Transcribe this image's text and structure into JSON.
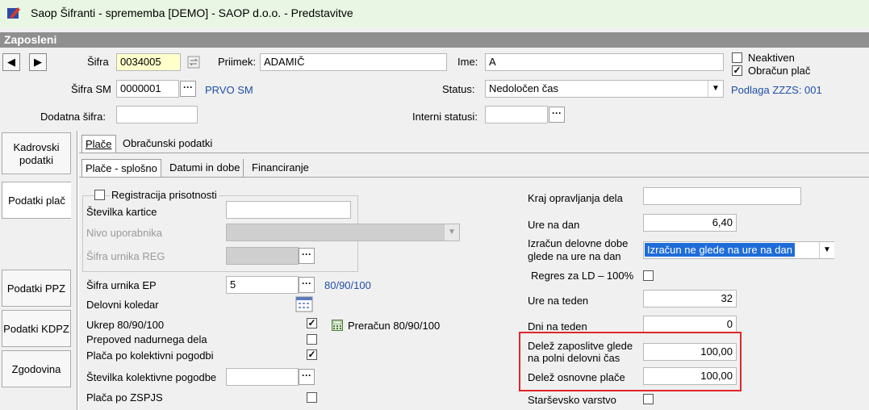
{
  "window": {
    "title": "Saop Šifranti - sprememba [DEMO] - SAOP d.o.o. - Predstavitve"
  },
  "section_title": "Zaposleni",
  "nav": {
    "prev": "◀",
    "next": "▶"
  },
  "top": {
    "sifra_label": "Šifra",
    "sifra_value": "0034005",
    "priimek_label": "Priimek:",
    "priimek_value": "ADAMIČ",
    "ime_label": "Ime:",
    "ime_value": "A",
    "neaktiven_label": "Neaktiven",
    "obracun_label": "Obračun plač",
    "sifra_sm_label": "Šifra SM",
    "sifra_sm_value": "0000001",
    "sm_name": "PRVO SM",
    "status_label": "Status:",
    "status_value": "Nedoločen čas",
    "podlaga": "Podlaga ZZZS: 001",
    "dodatna_label": "Dodatna šifra:",
    "interni_label": "Interni statusi:"
  },
  "sidebar": {
    "kadrovski": "Kadrovski podatki",
    "podatki_plac": "Podatki plač",
    "podatki_ppz": "Podatki PPZ",
    "podatki_kdpz": "Podatki KDPZ",
    "zgodovina": "Zgodovina"
  },
  "tabs": {
    "place": "Plače",
    "obracunski": "Obračunski podatki"
  },
  "subtabs": {
    "splosno": "Plače - splošno",
    "datumi": "Datumi in dobe",
    "financiranje": "Financiranje"
  },
  "left": {
    "registracija": "Registracija prisotnosti",
    "stevilka_kartice": "Številka kartice",
    "nivo": "Nivo uporabnika",
    "sifra_urnika_reg": "Šifra urnika REG",
    "sifra_urnika_ep": "Šifra urnika EP",
    "sifra_urnika_ep_value": "5",
    "urnik_info": "80/90/100",
    "delovni_koledar": "Delovni koledar",
    "ukrep": "Ukrep 80/90/100",
    "preracun": "Preračun 80/90/100",
    "prepoved": "Prepoved nadurnega dela",
    "placa_kolektivni": "Plača po kolektivni pogodbi",
    "stevilka_kolektivne": "Številka kolektivne pogodbe",
    "placa_zspjs": "Plača po ZSPJS"
  },
  "right": {
    "kraj": "Kraj opravljanja dela",
    "ure_na_dan": "Ure na dan",
    "ure_na_dan_value": "6,40",
    "izracun_label_1": "Izračun delovne dobe",
    "izracun_label_2": "glede na ure na dan",
    "izracun_value": "Izračun ne glede na ure na dan",
    "regres": "Regres za LD – 100%",
    "ure_na_teden": "Ure na teden",
    "ure_na_teden_value": "32",
    "dni_na_teden": "Dni na teden",
    "dni_na_teden_value": "0",
    "delez_zap_1": "Delež zaposlitve glede",
    "delez_zap_2": "na polni delovni čas",
    "delez_zap_value": "100,00",
    "delez_osn": "Delež osnovne plače",
    "delez_osn_value": "100,00",
    "starsevsko": "Starševsko varstvo"
  },
  "colors": {
    "highlight": "#e0262a",
    "link_blue": "#1f4fa6",
    "title_bg": "#e9f6e3",
    "header_bg": "#8f8f8f"
  }
}
